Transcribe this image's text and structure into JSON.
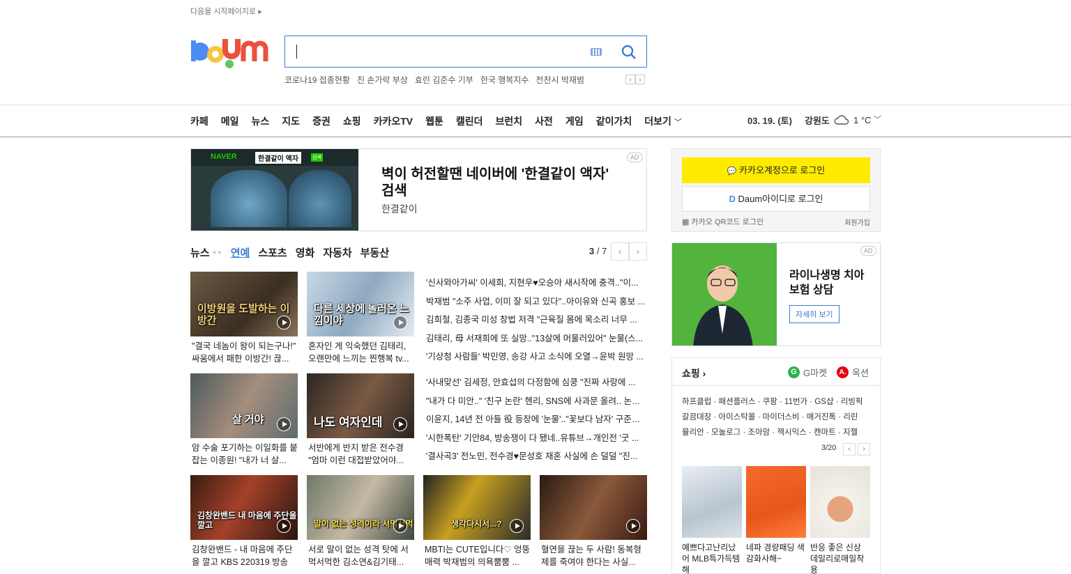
{
  "top_link": "다음을 시작페이지로 ▸",
  "logo": {
    "text": "Daum"
  },
  "search": {
    "placeholder": ""
  },
  "suggestions": [
    "코로나19 접종현황",
    "진 손가락 부상",
    "효린 김준수 기부",
    "한국 행복지수",
    "전찬시 박재범"
  ],
  "nav": {
    "items": [
      "카페",
      "메일",
      "뉴스",
      "지도",
      "증권",
      "쇼핑",
      "카카오TV",
      "웹툰",
      "캘린더",
      "브런치",
      "사전",
      "게임",
      "같이가치",
      "더보기"
    ],
    "date": "03. 19. (토)",
    "region": "강원도",
    "temperature": "1 °C"
  },
  "ad1": {
    "tag": "AD",
    "brand": "NAVER",
    "chip": "한결같이 액자",
    "chip2": "검색",
    "title": "벽이 허전할땐 네이버에 '한결같이 액자' 검색",
    "subtitle": "한결같이"
  },
  "news_tabs": {
    "items": [
      "뉴스",
      "연예",
      "스포츠",
      "영화",
      "자동차",
      "부동산"
    ],
    "active": "연예",
    "page_current": "3",
    "page_total": " / 7"
  },
  "thumb_news": [
    {
      "overlay": "이방원을 도발하는 이방간",
      "caption": "\"결국 네놈이 왕이 되는구나!\" 싸움에서 패한 이방간! 끊..."
    },
    {
      "overlay": "다른 세상에 놀러온 느낌이야",
      "caption": "혼자인 게 익숙했던 김태리, 오랜만에 느끼는 찐행복 tv..."
    },
    {
      "overlay": "살 거야",
      "caption": "암 수술 포기하는 이일화를 붙잡는 이종원! \"내가 너 살..."
    },
    {
      "overlay": "나도 여자인데",
      "caption": "서반에게 반지 받은 전수경 \"엄마 이런 대접받았어야..."
    },
    {
      "overlay": "김창완밴드 내 마음에 주단을 깔고",
      "caption": "김창완밴드 - 내 마음에 주단을 깔고 KBS 220319 방송"
    },
    {
      "overlay": "말이 없는 성격이라 서먹서먹",
      "caption": "서로 말이 없는 성격 탓에 서먹서먹한 김소연&김기태..."
    },
    {
      "overlay": "생각다시서...?",
      "caption": "MBTI는 CUTE입니다♡ 엉뚱매력 박재범의 의욕뿜뿜 ..."
    },
    {
      "overlay": "",
      "caption": "혈연을 끊는 두 사람! 동복형제를 죽여야 한다는 사실..."
    }
  ],
  "news_list_1": [
    "'신사와아가씨' 이세희, 지현우♥오승아 새시작에 충격..\"이...",
    "박재범 \"소주 사업, 이미 잘 되고 있다\"..아이유와 신곡 홍보 ...",
    "김희철, 김종국 미성 창법 저격 \"근육질 몸에 목소리 너무 ...",
    "김태리, 母 서재희에 또 실망..\"13살에 머물러있어\" 눈물(스...",
    "'기상청 사람들' 박민영, 송강 사고 소식에 오열→윤박 원망 ..."
  ],
  "news_list_2": [
    "'사내맞선' 김세정, 안효섭의 다정함에 심쿵 \"진짜 사랑에 ...",
    "\"내가 다 미안..\" '친구 논란' 헨리, SNS에 사과문 올려.. 논란 ...",
    "이윤지, 14년 전 아들 役 등장에 '눈물'..\"꽃보다 남자' 구준표...",
    "'시한폭탄' 기안84, 방송쟁이 다 됐네..유튜브→개인전 '굿 ...",
    "'결사곡3' 전노민, 전수경♥문성호 재혼 사실에 손 덜덜 \"진..."
  ],
  "login": {
    "kakao": "카카오계정으로 로그인",
    "daum": "Daum아이디로 로그인",
    "qr": "카카오 QR코드 로그인",
    "join": "회원가입"
  },
  "ad2": {
    "tag": "AD",
    "title": "라이나생명 치아보험 상담",
    "button": "자세히 보기"
  },
  "shopping": {
    "title": "쇼핑 ›",
    "gmarket": "G마켓",
    "auction": "옥션",
    "links": [
      "하프클럽 · 패션플러스 · 쿠팡 · 11번가 · GS샵 · 리빙픽",
      "갈끔대장 · 아이스탁몰 · 마이더스비 · 매거진톡 · 리린",
      "뮬리안 · 모놀로그 · 조아맘 · 젝시믹스 · 캔마트 · 지젤"
    ],
    "page": "3/20",
    "products": [
      {
        "caption": "예쁘다고난리났어 MLB특가득템해"
      },
      {
        "caption": "네파 경량패딩 색감화사해~"
      },
      {
        "caption": "반응 좋은 신상 데일리로매일착용"
      }
    ]
  },
  "colors": {
    "accent": "#3a7bd5",
    "kakao": "#ffeb00",
    "gmarket": "#2bb24c",
    "auction": "#e60012"
  }
}
